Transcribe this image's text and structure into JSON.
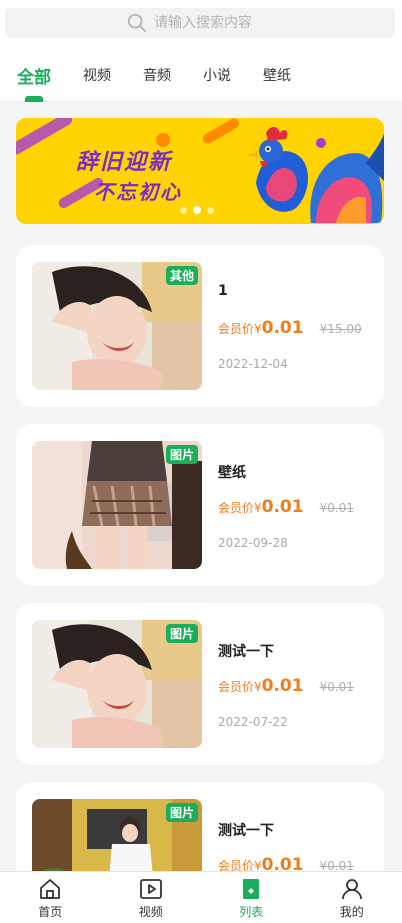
{
  "search": {
    "placeholder": "请输入搜索内容"
  },
  "tabs": [
    {
      "label": "全部",
      "active": true
    },
    {
      "label": "视频"
    },
    {
      "label": "音频"
    },
    {
      "label": "小说"
    },
    {
      "label": "壁纸"
    }
  ],
  "banner": {
    "line1": "辞旧迎新",
    "line2": "不忘初心",
    "slides": 3,
    "active_slide": 1
  },
  "items": [
    {
      "badge": "其他",
      "title": "1",
      "price_label": "会员价¥",
      "price": "0.01",
      "original": "¥15.00",
      "date": "2022-12-04",
      "image": "photo-woman-smiling"
    },
    {
      "badge": "图片",
      "title": "壁纸",
      "price_label": "会员价¥",
      "price": "0.01",
      "original": "¥0.01",
      "date": "2022-09-28",
      "image": "photo-skirt-desk"
    },
    {
      "badge": "图片",
      "title": "测试一下",
      "price_label": "会员价¥",
      "price": "0.01",
      "original": "¥0.01",
      "date": "2022-07-22",
      "image": "photo-woman-smiling"
    },
    {
      "badge": "图片",
      "title": "测试一下",
      "price_label": "会员价¥",
      "price": "0.01",
      "original": "¥0.01",
      "date": "",
      "image": "photo-street-cafe"
    }
  ],
  "tabbar": [
    {
      "label": "首页",
      "icon": "home-icon"
    },
    {
      "label": "视频",
      "icon": "video-icon"
    },
    {
      "label": "列表",
      "icon": "list-icon",
      "active": true
    },
    {
      "label": "我的",
      "icon": "user-icon"
    }
  ],
  "colors": {
    "accent": "#1aad5a",
    "price": "#f07d1a",
    "banner": "#ffd400"
  }
}
